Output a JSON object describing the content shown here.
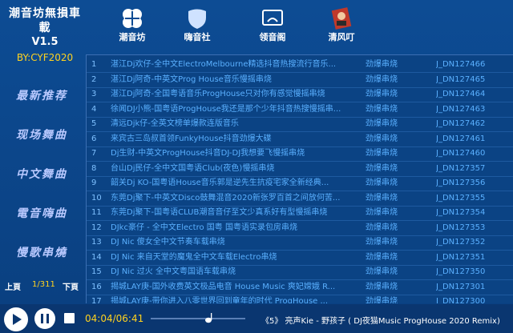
{
  "app": {
    "title": "潮音坊無損車載",
    "version": "V1.5",
    "author": "BY:CYF2020"
  },
  "nav": [
    {
      "label": "潮音坊",
      "icon": "clover-icon"
    },
    {
      "label": "嗨音社",
      "icon": "shield-icon"
    },
    {
      "label": "领音阁",
      "icon": "screen-icon"
    },
    {
      "label": "清风叮",
      "icon": "portrait-icon"
    }
  ],
  "side": [
    "最新推荐",
    "现场舞曲",
    "中文舞曲",
    "電音嗨曲",
    "慢歌串燒"
  ],
  "pager": {
    "prev": "上頁",
    "page": "1/311",
    "next": "下頁"
  },
  "rows": [
    {
      "n": "1",
      "title": "湛江Dj欢仔-全中文ElectroMelbourne精选抖音热搜流行音乐...",
      "artist": "劲爆串烧",
      "id": "J_DN127466"
    },
    {
      "n": "2",
      "title": "湛江Dj阿奇-中英文Prog House音乐慢摇串烧",
      "artist": "劲爆串烧",
      "id": "J_DN127465"
    },
    {
      "n": "3",
      "title": "湛江Dj阿奇-全国粤语音乐ProgHouse只对你有感觉慢摇串烧",
      "artist": "劲爆串烧",
      "id": "J_DN127464"
    },
    {
      "n": "4",
      "title": "徐闻DJ小熊-国粤语ProgHouse我还是那个少年抖音热搜慢摇串...",
      "artist": "劲爆串烧",
      "id": "J_DN127463"
    },
    {
      "n": "5",
      "title": "清远Djk仔-全英文榜单爆款连版音乐",
      "artist": "劲爆串烧",
      "id": "J_DN127462"
    },
    {
      "n": "6",
      "title": "来宾古三岛叔首领FunkyHouse抖音劲爆大碟",
      "artist": "劲爆串烧",
      "id": "J_DN127461"
    },
    {
      "n": "7",
      "title": "Dj生财-中英文ProgHouse抖音DJ-DJ我想要飞慢摇串烧",
      "artist": "劲爆串烧",
      "id": "J_DN127460"
    },
    {
      "n": "8",
      "title": "台山Dj民仔-全中文国粤语Club(夜色)慢摇串烧",
      "artist": "劲爆串烧",
      "id": "J_DN127357"
    },
    {
      "n": "9",
      "title": "韶关Dj KO-国粤语House音乐郭是逆先生抗疫宅家全新经典...",
      "artist": "劲爆串烧",
      "id": "J_DN127356"
    },
    {
      "n": "10",
      "title": "东莞Dj聚下-中英文Disco鼓舞混音2020新张罗百首之间放何苦...",
      "artist": "劲爆串烧",
      "id": "J_DN127355"
    },
    {
      "n": "11",
      "title": "东莞Dj聚下-国粤语CLUB潮音音仔至文少真系好有型慢摇串烧",
      "artist": "劲爆串烧",
      "id": "J_DN127354"
    },
    {
      "n": "12",
      "title": "DJkc豪仔 - 全中文Electro 国粤 国粤语实录包房串烧",
      "artist": "劲爆串烧",
      "id": "J_DN127353"
    },
    {
      "n": "13",
      "title": "DJ Nic 傻女全中文节奏车载串烧",
      "artist": "劲爆串烧",
      "id": "J_DN127352"
    },
    {
      "n": "14",
      "title": "DJ Nic 来自天堂的魔鬼全中文车载Electro串烧",
      "artist": "劲爆串烧",
      "id": "J_DN127351"
    },
    {
      "n": "15",
      "title": "DJ Nic 过火 全中文粤国语车载串烧",
      "artist": "劲爆串烧",
      "id": "J_DN127350"
    },
    {
      "n": "16",
      "title": "揭城LAY庚-国外收费英文极品电音 House Music 爽妃嫦娥 R...",
      "artist": "劲爆串烧",
      "id": "J_DN127301"
    },
    {
      "n": "17",
      "title": "揭城LAY庚-带你进入八零世界回到童年的时代 ProgHouse ...",
      "artist": "劲爆串烧",
      "id": "J_DN127300"
    }
  ],
  "player": {
    "time": "04:04/06:41",
    "now_playing": "《5》 亮声Kie - 野孩子 ( DJ夜猫Music ProgHouse 2020 Remix)",
    "progress": 0.61
  }
}
